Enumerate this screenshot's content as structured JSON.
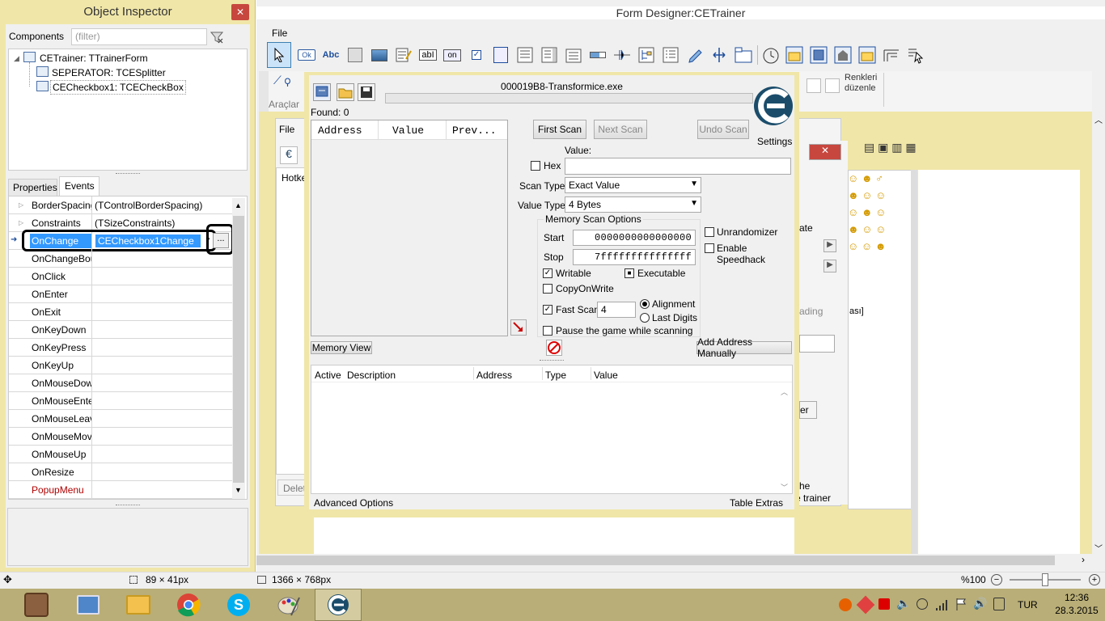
{
  "inspector": {
    "title": "Object Inspector",
    "components_label": "Components",
    "filter_placeholder": "(filter)",
    "tree": [
      "CETrainer: TTrainerForm",
      "SEPERATOR: TCESplitter",
      "CECheckbox1: TCECheckBox"
    ],
    "tabs": [
      "Properties",
      "Events"
    ],
    "rows": [
      {
        "key": "BorderSpacing",
        "value": "(TControlBorderSpacing)"
      },
      {
        "key": "Constraints",
        "value": "(TSizeConstraints)"
      },
      {
        "key": "OnChange",
        "value": "CECheckbox1Change"
      },
      {
        "key": "OnChangeBounds",
        "value": ""
      },
      {
        "key": "OnClick",
        "value": ""
      },
      {
        "key": "OnEnter",
        "value": ""
      },
      {
        "key": "OnExit",
        "value": ""
      },
      {
        "key": "OnKeyDown",
        "value": ""
      },
      {
        "key": "OnKeyPress",
        "value": ""
      },
      {
        "key": "OnKeyUp",
        "value": ""
      },
      {
        "key": "OnMouseDown",
        "value": ""
      },
      {
        "key": "OnMouseEnter",
        "value": ""
      },
      {
        "key": "OnMouseLeave",
        "value": ""
      },
      {
        "key": "OnMouseMove",
        "value": ""
      },
      {
        "key": "OnMouseUp",
        "value": ""
      },
      {
        "key": "OnResize",
        "value": ""
      },
      {
        "key": "PopupMenu",
        "value": ""
      }
    ],
    "ellipsis": "...",
    "status_size": "89 × 41px"
  },
  "designer": {
    "title": "Form Designer:CETrainer",
    "menu_file": "File",
    "status_size": "1366 × 768px",
    "zoom": "%100",
    "palette_ok": "Ok",
    "palette_abc": "Abc",
    "palette_on": "on",
    "renkleri": "Renkleri",
    "duzenle": "düzenle",
    "araclar": "Araçlar",
    "bg_file": "File",
    "bg_hotk": "Hotke",
    "bg_delet": "Delet",
    "bg_ate": "ate",
    "bg_ading": "ading",
    "bg_asi": "ası]",
    "bg_er": "er",
    "bg_he": "he",
    "bg_trainer": "e trainer",
    "bg_z": "ze"
  },
  "ce": {
    "process": "000019B8-Transformice.exe",
    "found": "Found: 0",
    "cols": [
      "Address",
      "Value",
      "Prev..."
    ],
    "first_scan": "First Scan",
    "next_scan": "Next Scan",
    "undo_scan": "Undo Scan",
    "settings": "Settings",
    "value_label": "Value:",
    "hex": "Hex",
    "scan_type_label": "Scan Type",
    "scan_type": "Exact Value",
    "value_type_label": "Value Type",
    "value_type": "4 Bytes",
    "mem_opts": "Memory Scan Options",
    "start_label": "Start",
    "start": "0000000000000000",
    "stop_label": "Stop",
    "stop": "7fffffffffffffff",
    "writable": "Writable",
    "executable": "Executable",
    "copyonwrite": "CopyOnWrite",
    "fast_scan": "Fast Scan",
    "fast_val": "4",
    "alignment": "Alignment",
    "last_digits": "Last Digits",
    "pause": "Pause the game while scanning",
    "unrandomizer": "Unrandomizer",
    "speedhack": "Enable Speedhack",
    "memory_view": "Memory View",
    "add_manual": "Add Address Manually",
    "table_cols": [
      "Active",
      "Description",
      "Address",
      "Type",
      "Value"
    ],
    "advanced": "Advanced Options",
    "table_extras": "Table Extras"
  },
  "taskbar": {
    "lang": "TUR",
    "time": "12:36",
    "date": "28.3.2015"
  },
  "colors": {
    "frame": "#f0e6a8",
    "selection": "#3399ff",
    "taskbar": "#b9ae77"
  }
}
